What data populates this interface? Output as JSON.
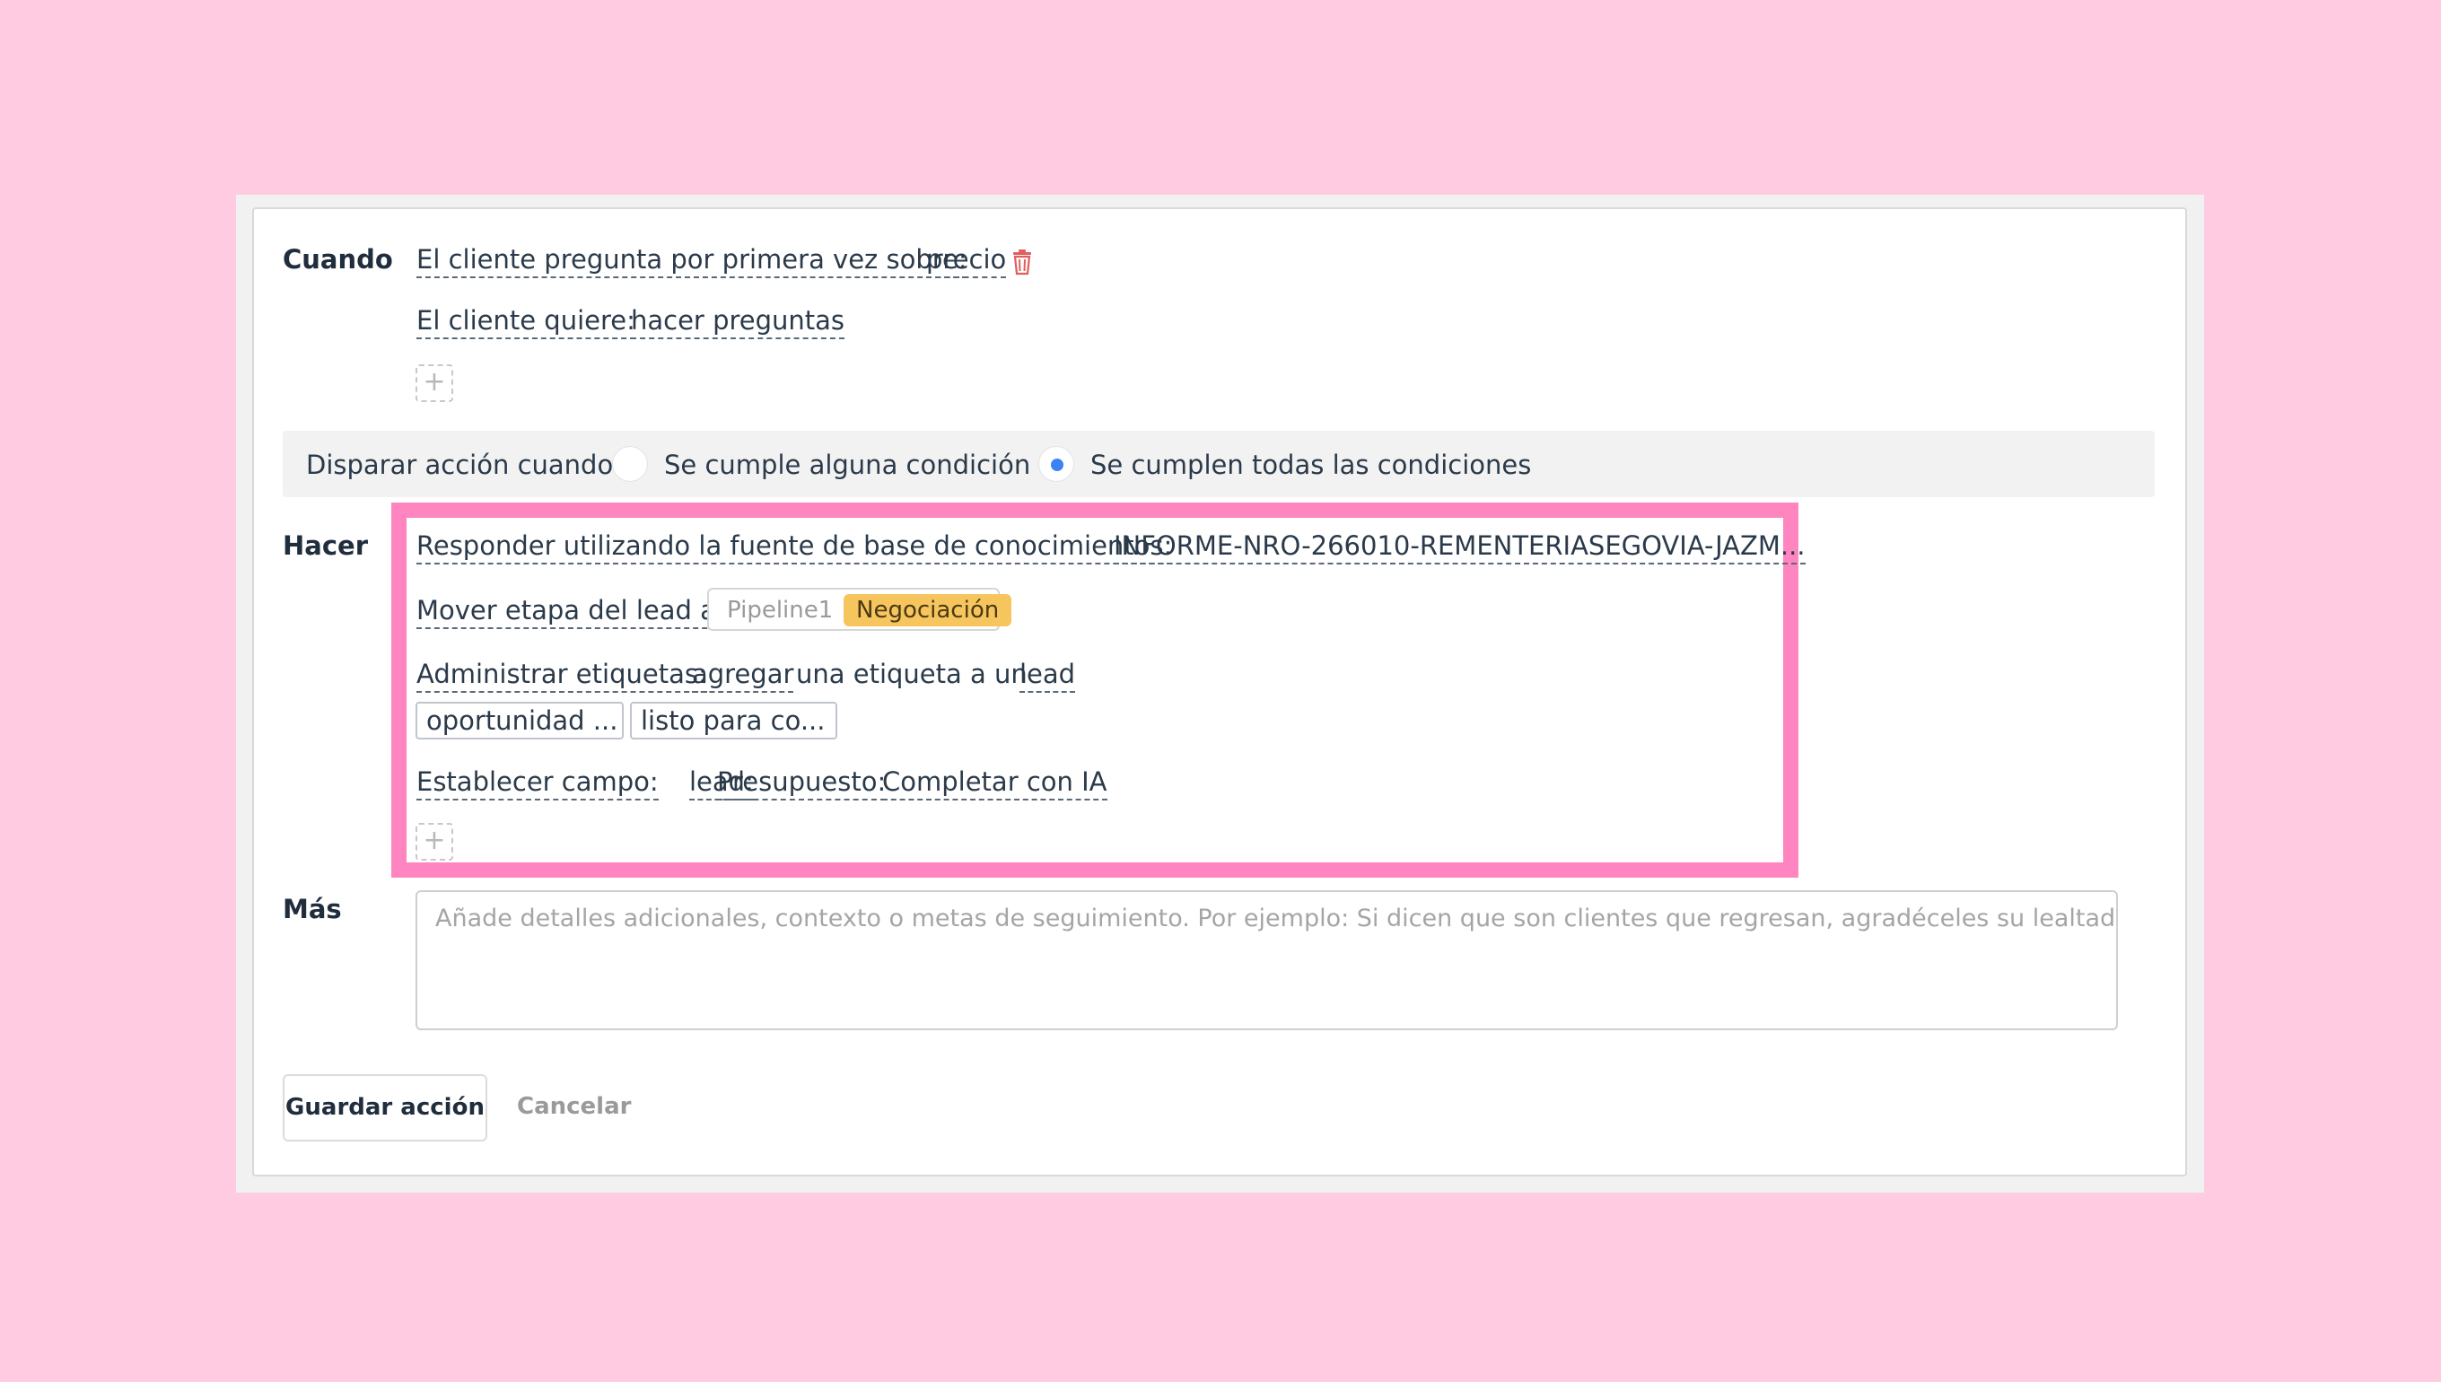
{
  "when": {
    "label": "Cuando",
    "conditions": [
      {
        "label": "El cliente pregunta por primera vez sobre:",
        "value": "precio",
        "icon": "trash-icon"
      },
      {
        "label": "El cliente quiere:",
        "value": "hacer preguntas"
      }
    ],
    "add_symbol": "+"
  },
  "trigger": {
    "label": "Disparar acción cuando:",
    "options": [
      {
        "label": "Se cumple alguna condición",
        "selected": false
      },
      {
        "label": "Se cumplen todas las condiciones",
        "selected": true
      }
    ],
    "accent_color": "#3b82f6"
  },
  "do": {
    "label": "Hacer",
    "actions": {
      "respond": {
        "label": "Responder utilizando la fuente de base de conocimientos:",
        "value": "INFORME-NRO-266010-REMENTERIASEGOVIA-JAZM..."
      },
      "move_stage": {
        "label": "Mover etapa del lead a:",
        "pipeline": "Pipeline1",
        "stage": "Negociación",
        "stage_color": "#F7C55E"
      },
      "tags": {
        "label": "Administrar etiquetas:",
        "operation": "agregar",
        "middle_text": "una etiqueta a un",
        "entity": "lead",
        "chips": [
          "oportunidad ...",
          "listo para co..."
        ]
      },
      "set_field": {
        "label": "Establecer campo:",
        "entity": "lead:",
        "field": "Presupuesto:",
        "value": "Completar con IA"
      }
    },
    "add_symbol": "+",
    "highlight_color": "#FF85C0"
  },
  "more": {
    "label": "Más",
    "placeholder": "Añade detalles adicionales, contexto o metas de seguimiento. Por ejemplo: Si dicen que son clientes que regresan, agradéceles su lealtad."
  },
  "footer": {
    "save_label": "Guardar acción",
    "cancel_label": "Cancelar"
  },
  "colors": {
    "background": "#FFCBE0",
    "trash": "#e35d5d"
  }
}
